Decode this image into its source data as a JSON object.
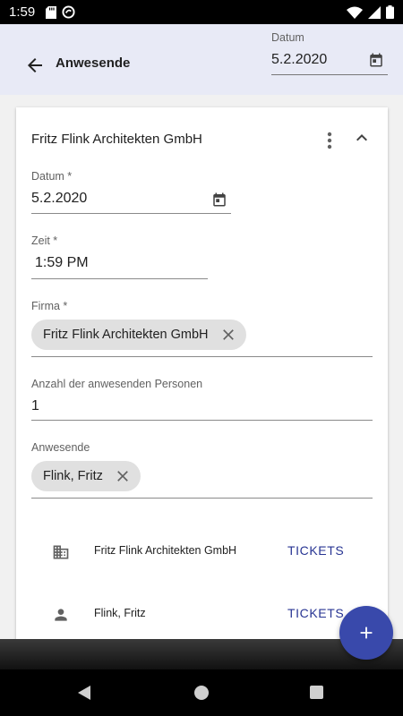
{
  "status_bar": {
    "time": "1:59"
  },
  "app_bar": {
    "title": "Anwesende",
    "date_label": "Datum",
    "date_value": "5.2.2020"
  },
  "card": {
    "title": "Fritz Flink Architekten GmbH",
    "date": {
      "label": "Datum *",
      "value": "5.2.2020"
    },
    "time": {
      "label": "Zeit *",
      "value": "1:59 PM"
    },
    "company": {
      "label": "Firma *",
      "chip": "Fritz Flink Architekten GmbH"
    },
    "count": {
      "label": "Anzahl der anwesenden Personen",
      "value": "1"
    },
    "attendees": {
      "label": "Anwesende",
      "chip": "Flink, Fritz"
    },
    "summary": [
      {
        "icon": "building-icon",
        "name": "Fritz Flink Architekten GmbH",
        "button": "TICKETS"
      },
      {
        "icon": "person-icon",
        "name": "Flink, Fritz",
        "button": "TICKETS"
      }
    ]
  },
  "colors": {
    "app_bar_bg": "#e8eaf6",
    "accent": "#3949ab",
    "tickets_text": "#283593"
  }
}
